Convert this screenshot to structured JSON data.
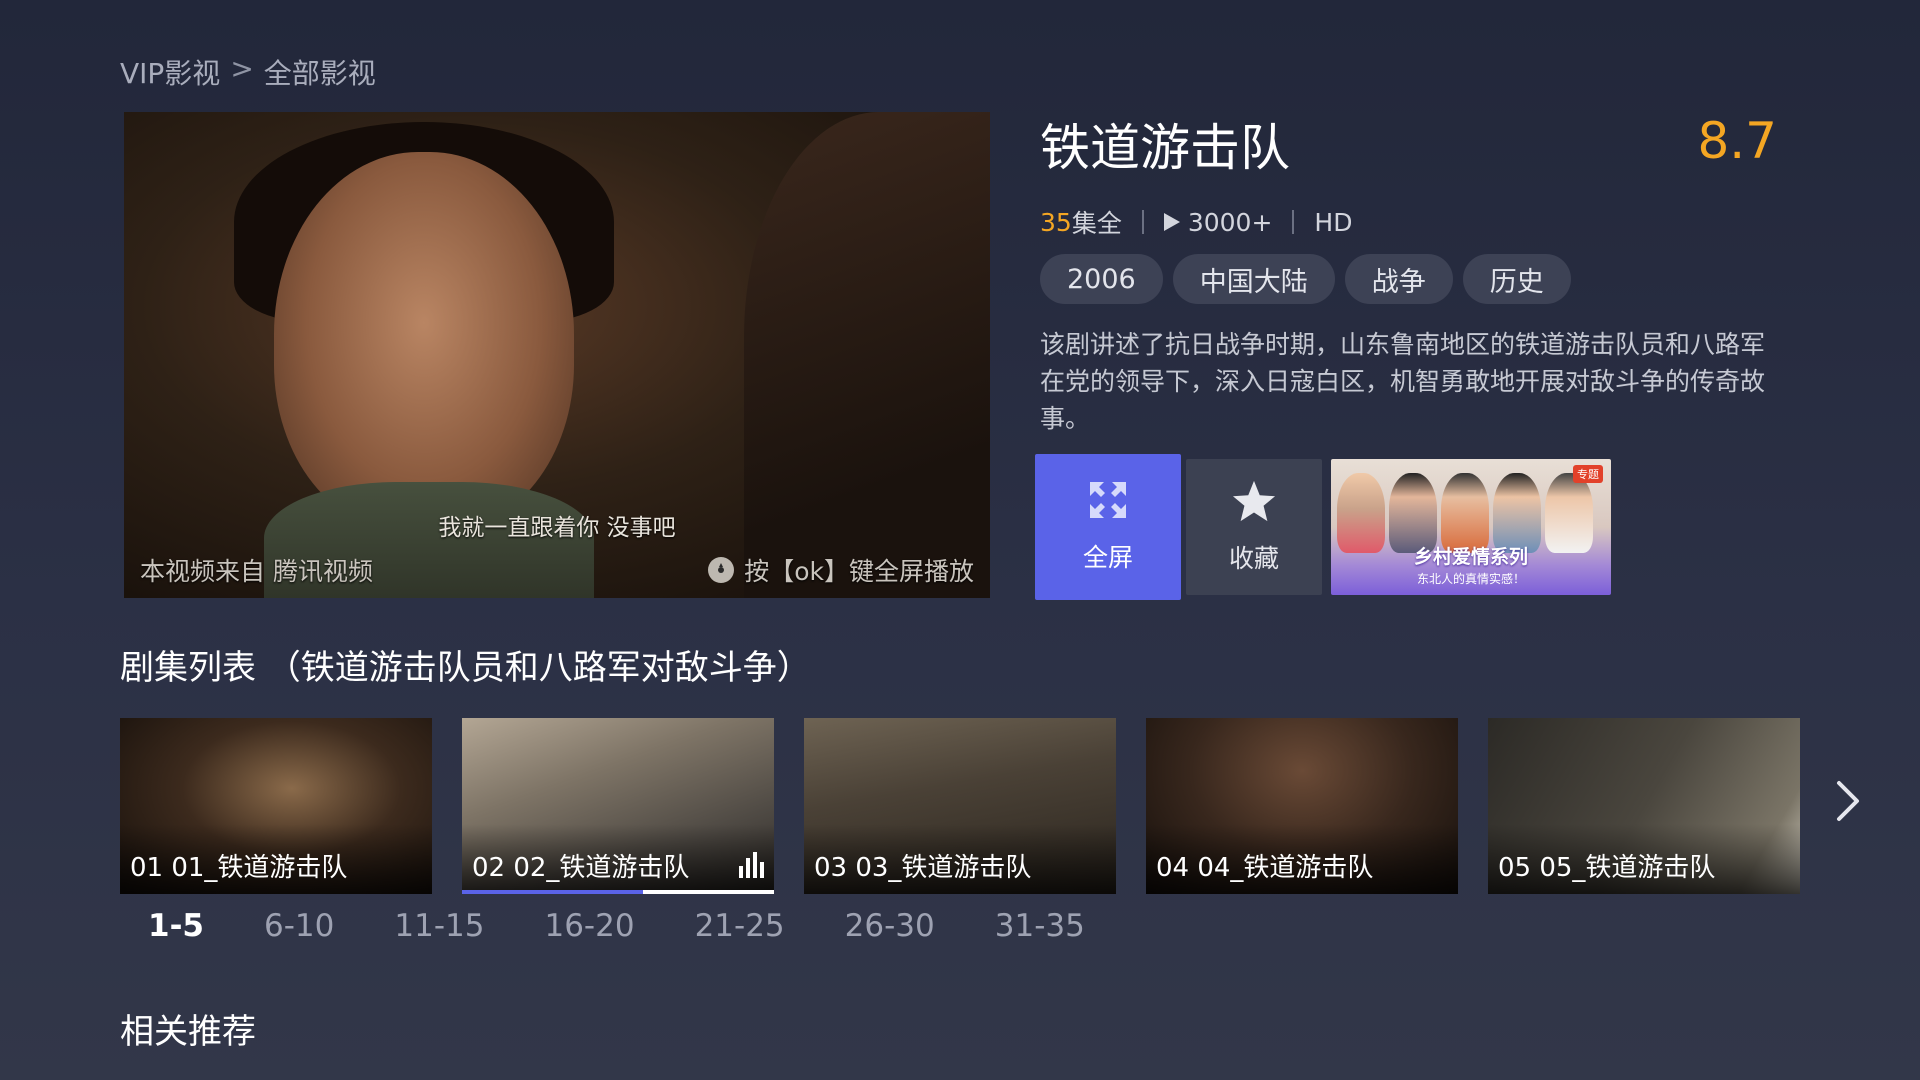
{
  "breadcrumb": {
    "root": "VIP影视",
    "separator": ">",
    "current": "全部影视"
  },
  "player": {
    "subtitle": "我就一直跟着你 没事吧",
    "source_text": "本视频来自 腾讯视频",
    "hint_text": "按【ok】键全屏播放"
  },
  "show": {
    "title": "铁道游击队",
    "score": "8.7",
    "episode_count": "35",
    "episode_suffix": "集全",
    "plays": "3000+",
    "quality": "HD",
    "tags": [
      "2006",
      "中国大陆",
      "战争",
      "历史"
    ],
    "description": "该剧讲述了抗日战争时期，山东鲁南地区的铁道游击队员和八路军在党的领导下，深入日寇白区，机智勇敢地开展对敌斗争的传奇故事。"
  },
  "actions": {
    "fullscreen_label": "全屏",
    "favorite_label": "收藏",
    "banner": {
      "badge": "专题",
      "title": "乡村爱情系列",
      "subtitle": "东北人的真情实感！"
    }
  },
  "episodes": {
    "section_title": "剧集列表 （铁道游击队员和八路军对敌斗争）",
    "items": [
      {
        "label": "01 01_铁道游击队"
      },
      {
        "label": "02 02_铁道游击队",
        "playing": true,
        "progress": 0.58
      },
      {
        "label": "03 03_铁道游击队"
      },
      {
        "label": "04 04_铁道游击队"
      },
      {
        "label": "05 05_铁道游击队"
      }
    ],
    "pages": [
      "1-5",
      "6-10",
      "11-15",
      "16-20",
      "21-25",
      "26-30",
      "31-35"
    ],
    "active_page": "1-5"
  },
  "recommend": {
    "title": "相关推荐"
  },
  "colors": {
    "accent": "#5a63e8",
    "score": "#f4a623"
  }
}
